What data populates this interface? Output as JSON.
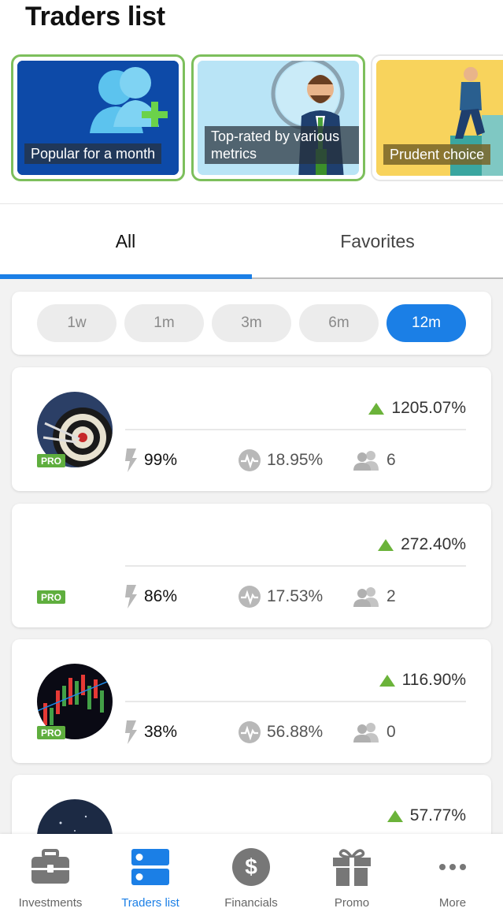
{
  "page": {
    "title": "Traders list"
  },
  "categories": [
    {
      "label": "Popular for a month"
    },
    {
      "label": "Top-rated by various metrics"
    },
    {
      "label": "Prudent choice"
    }
  ],
  "tabs": [
    {
      "label": "All"
    },
    {
      "label": "Favorites"
    }
  ],
  "periods": [
    {
      "label": "1w"
    },
    {
      "label": "1m"
    },
    {
      "label": "3m"
    },
    {
      "label": "6m"
    },
    {
      "label": "12m",
      "active": true
    }
  ],
  "traders": [
    {
      "pro": "PRO",
      "gain": "1205.07%",
      "risk": "99%",
      "drawdown": "18.95%",
      "investors": "6"
    },
    {
      "pro": "PRO",
      "gain": "272.40%",
      "risk": "86%",
      "drawdown": "17.53%",
      "investors": "2"
    },
    {
      "pro": "PRO",
      "gain": "116.90%",
      "risk": "38%",
      "drawdown": "56.88%",
      "investors": "0"
    },
    {
      "gain": "57.77%"
    }
  ],
  "nav": [
    {
      "label": "Investments",
      "icon": "briefcase-icon"
    },
    {
      "label": "Traders list",
      "icon": "traders-list-icon",
      "active": true
    },
    {
      "label": "Financials",
      "icon": "dollar-icon"
    },
    {
      "label": "Promo",
      "icon": "gift-icon"
    },
    {
      "label": "More",
      "icon": "more-icon"
    }
  ],
  "colors": {
    "accent": "#1b7fe6",
    "positive": "#6bb33a",
    "pro_badge": "#5fae3e",
    "selected_border": "#7dbf5c"
  }
}
